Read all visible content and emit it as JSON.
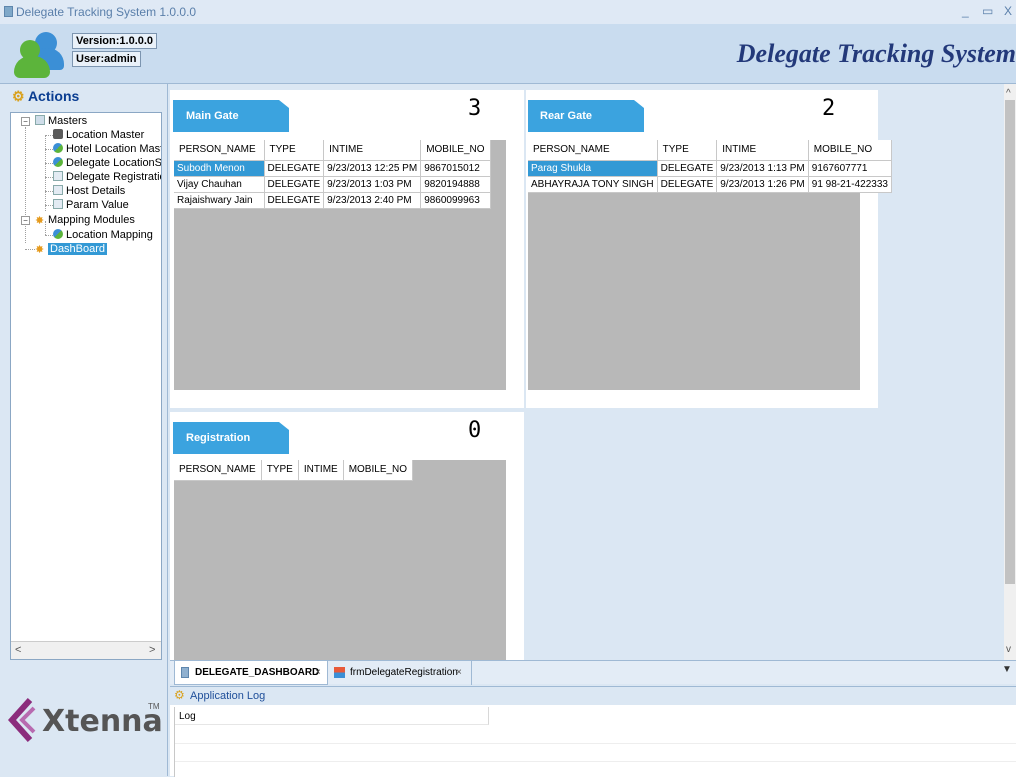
{
  "window": {
    "title": "Delegate Tracking System 1.0.0.0",
    "controls": [
      "_",
      "▭",
      "X"
    ]
  },
  "header": {
    "version": "Version:1.0.0.0",
    "user": "User:admin",
    "app_title": "Delegate Tracking System"
  },
  "sidebar": {
    "title": "Actions",
    "tree": {
      "masters": {
        "label": "Masters",
        "items": [
          {
            "label": "Location Master",
            "icon": "traffic-light-icon"
          },
          {
            "label": "Hotel Location Master",
            "icon": "users-icon"
          },
          {
            "label": "Delegate LocationSe",
            "icon": "users-icon"
          },
          {
            "label": "Delegate Registratio",
            "icon": "form-icon"
          },
          {
            "label": "Host Details",
            "icon": "form-icon"
          },
          {
            "label": "Param Value",
            "icon": "form-icon"
          }
        ]
      },
      "mapping": {
        "label": "Mapping Modules",
        "items": [
          {
            "label": "Location Mapping",
            "icon": "users-icon"
          }
        ]
      },
      "dashboard": {
        "label": "DashBoard"
      }
    },
    "logo_text": "Xtenna",
    "logo_tm": "TM"
  },
  "dashboard": {
    "columns": [
      "PERSON_NAME",
      "TYPE",
      "INTIME",
      "MOBILE_NO"
    ],
    "main_gate": {
      "label": "Main Gate",
      "count": "3",
      "rows": [
        [
          "Subodh Menon",
          "DELEGATE",
          "9/23/2013 12:25 PM",
          "9867015012"
        ],
        [
          "Vijay Chauhan",
          "DELEGATE",
          "9/23/2013 1:03 PM",
          "9820194888"
        ],
        [
          "Rajaishwary Jain",
          "DELEGATE",
          "9/23/2013 2:40 PM",
          "9860099963"
        ]
      ]
    },
    "rear_gate": {
      "label": "Rear Gate",
      "count": "2",
      "rows": [
        [
          "Parag Shukla",
          "DELEGATE",
          "9/23/2013 1:13 PM",
          "9167607771"
        ],
        [
          "ABHAYRAJA TONY SINGH",
          "DELEGATE",
          "9/23/2013 1:26 PM",
          "91 98-21-422333"
        ]
      ]
    },
    "registration": {
      "label": "Registration",
      "count": "0",
      "rows": []
    }
  },
  "tabs": [
    {
      "label": "DELEGATE_DASHBOARD",
      "active": true
    },
    {
      "label": "frmDelegateRegistration",
      "active": false
    }
  ],
  "tab_close": "×",
  "tab_menu": "▼",
  "log": {
    "title": "Application Log",
    "column": "Log"
  },
  "scroll": {
    "up": "^",
    "down": "v",
    "left": "<",
    "right": ">"
  },
  "colors": {
    "accent_blue": "#3399d5",
    "app_title": "#23397a",
    "selected_row": "#3399d5"
  }
}
